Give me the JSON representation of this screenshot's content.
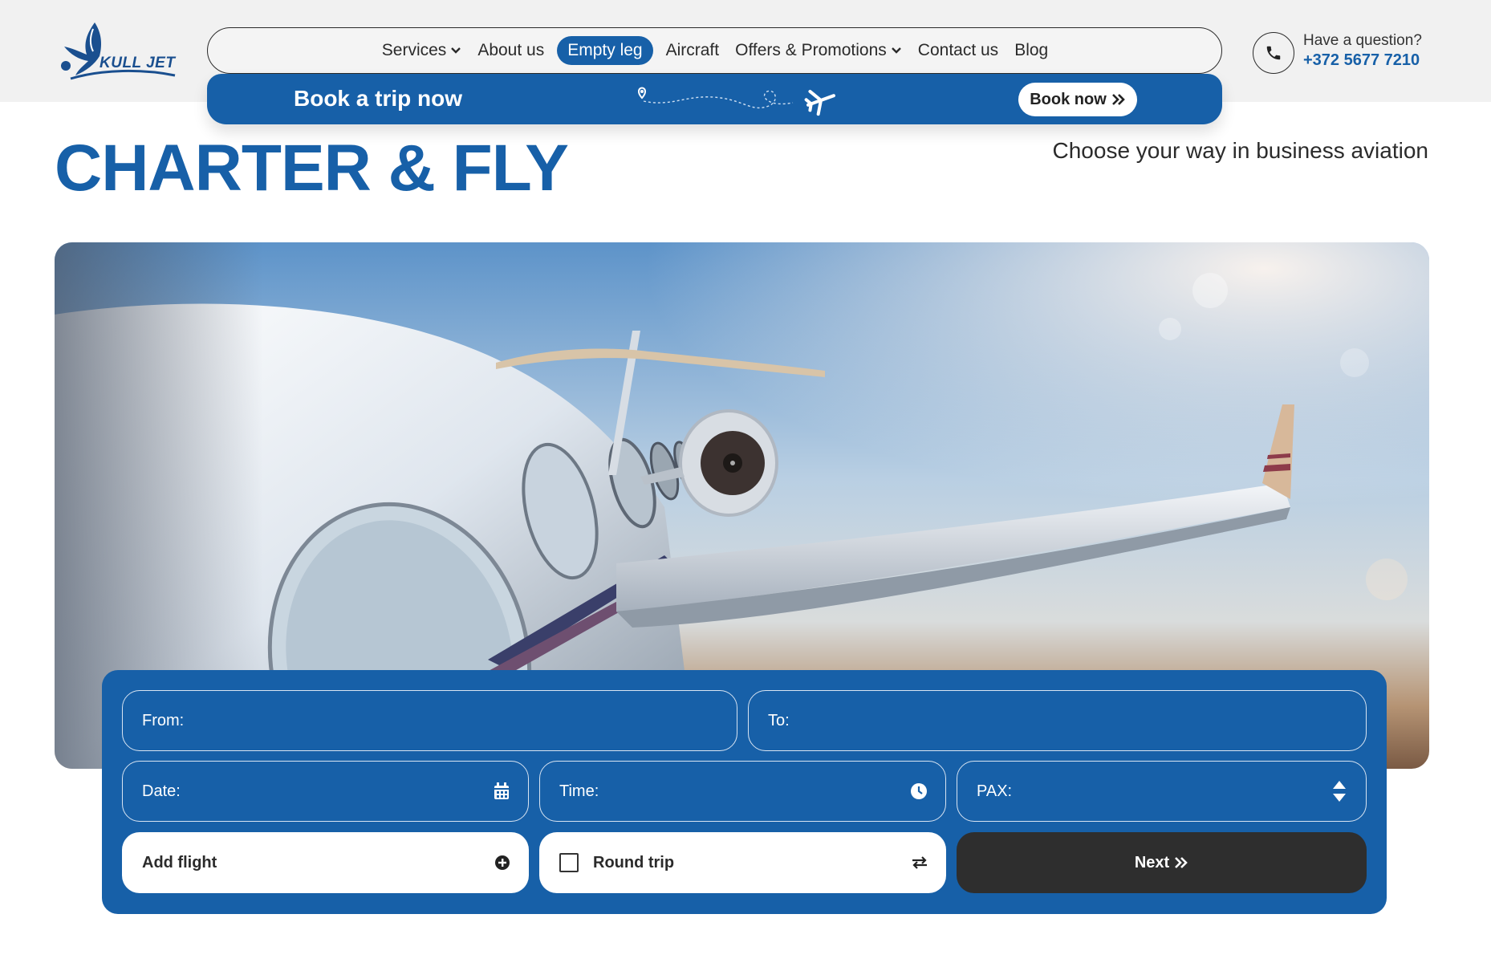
{
  "brand": {
    "logo_text": "KULL JET"
  },
  "nav": {
    "items": [
      {
        "label": "Services",
        "has_dropdown": true
      },
      {
        "label": "About us",
        "has_dropdown": false
      },
      {
        "label": "Empty leg",
        "has_dropdown": false,
        "active": true
      },
      {
        "label": "Aircraft",
        "has_dropdown": false
      },
      {
        "label": "Offers & Promotions",
        "has_dropdown": true
      },
      {
        "label": "Contact us",
        "has_dropdown": false
      },
      {
        "label": "Blog",
        "has_dropdown": false
      }
    ]
  },
  "booking_bar": {
    "title": "Book a trip now",
    "button_label": "Book now",
    "icon": "chevron-double-right-icon"
  },
  "contact": {
    "question": "Have a question?",
    "phone": "+372 5677 7210",
    "icon": "phone-icon"
  },
  "hero": {
    "title": "CHARTER & FLY",
    "subtitle": "Choose your way in business aviation"
  },
  "form": {
    "from_label": "From:",
    "to_label": "To:",
    "date_label": "Date:",
    "time_label": "Time:",
    "pax_label": "PAX:",
    "add_flight_label": "Add flight",
    "round_trip_label": "Round trip",
    "round_trip_checked": false,
    "next_label": "Next"
  },
  "colors": {
    "brand_blue": "#1760a8",
    "dark_button": "#2e2e2e",
    "header_bg": "#f1f1f1"
  }
}
